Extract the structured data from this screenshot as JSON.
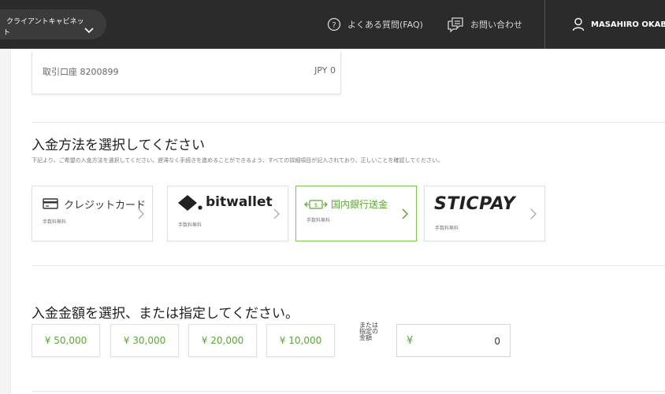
{
  "header": {
    "cabinet_line1": "クライアントキャビネッ",
    "cabinet_line2": "ト",
    "faq": "よくある質問(FAQ)",
    "contact": "お問い合わせ",
    "user": "MASAHIRO OKABE"
  },
  "account": {
    "name": "取引口座 8200899",
    "balance": "JPY 0"
  },
  "method_section": {
    "title": "入金方法を選択してください",
    "description": "下記より、ご希望の入金方法を選択してください。遅滞なく手続きを進めることができるよう、すべての詳細項目が記入されており、正しいことを確認してください。",
    "methods": [
      {
        "label": "クレジットカード",
        "fee": "手数料無料"
      },
      {
        "label": "bitwallet",
        "fee": "手数料無料"
      },
      {
        "label": "国内銀行送金",
        "fee": "手数料無料"
      },
      {
        "label": "STICPAY",
        "fee": "手数料無料"
      }
    ]
  },
  "amount_section": {
    "title": "入金金額を選択、または指定してください。",
    "presets": [
      "¥ 50,000",
      "¥ 30,000",
      "¥ 20,000",
      "¥ 10,000"
    ],
    "custom_note": "または指定の金額",
    "currency": "¥",
    "value": "0"
  },
  "colors": {
    "accent": "#5aa832",
    "header_bg": "#2b2b2b"
  }
}
